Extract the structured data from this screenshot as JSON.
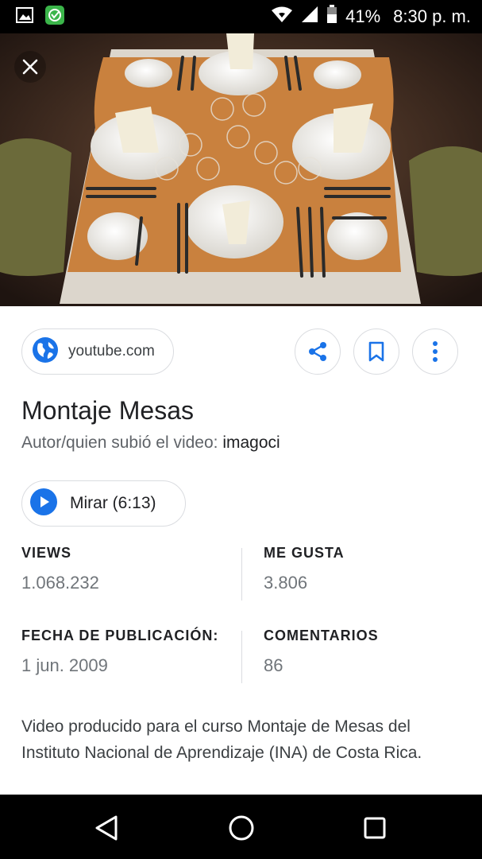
{
  "status_bar": {
    "battery_percent": "41%",
    "time": "8:30 p. m."
  },
  "hero": {
    "image_description": "table-setting-photo"
  },
  "source": {
    "domain": "youtube.com"
  },
  "video": {
    "title": "Montaje Mesas",
    "author_prefix": "Autor/quien subió el video: ",
    "author": "imagoci",
    "watch_label": "Mirar (6:13)"
  },
  "stats": {
    "views_label": "VIEWS",
    "views_value": "1.068.232",
    "likes_label": "ME GUSTA",
    "likes_value": "3.806",
    "date_label": "FECHA DE PUBLICACIÓN:",
    "date_value": "1 jun. 2009",
    "comments_label": "COMENTARIOS",
    "comments_value": "86"
  },
  "description": "Video producido para el curso Montaje de Mesas del Instituto Nacional de Aprendizaje (INA) de Costa Rica.",
  "colors": {
    "accent_blue": "#1a73e8",
    "status_bar": "#000000",
    "nav_bar": "#000000"
  }
}
